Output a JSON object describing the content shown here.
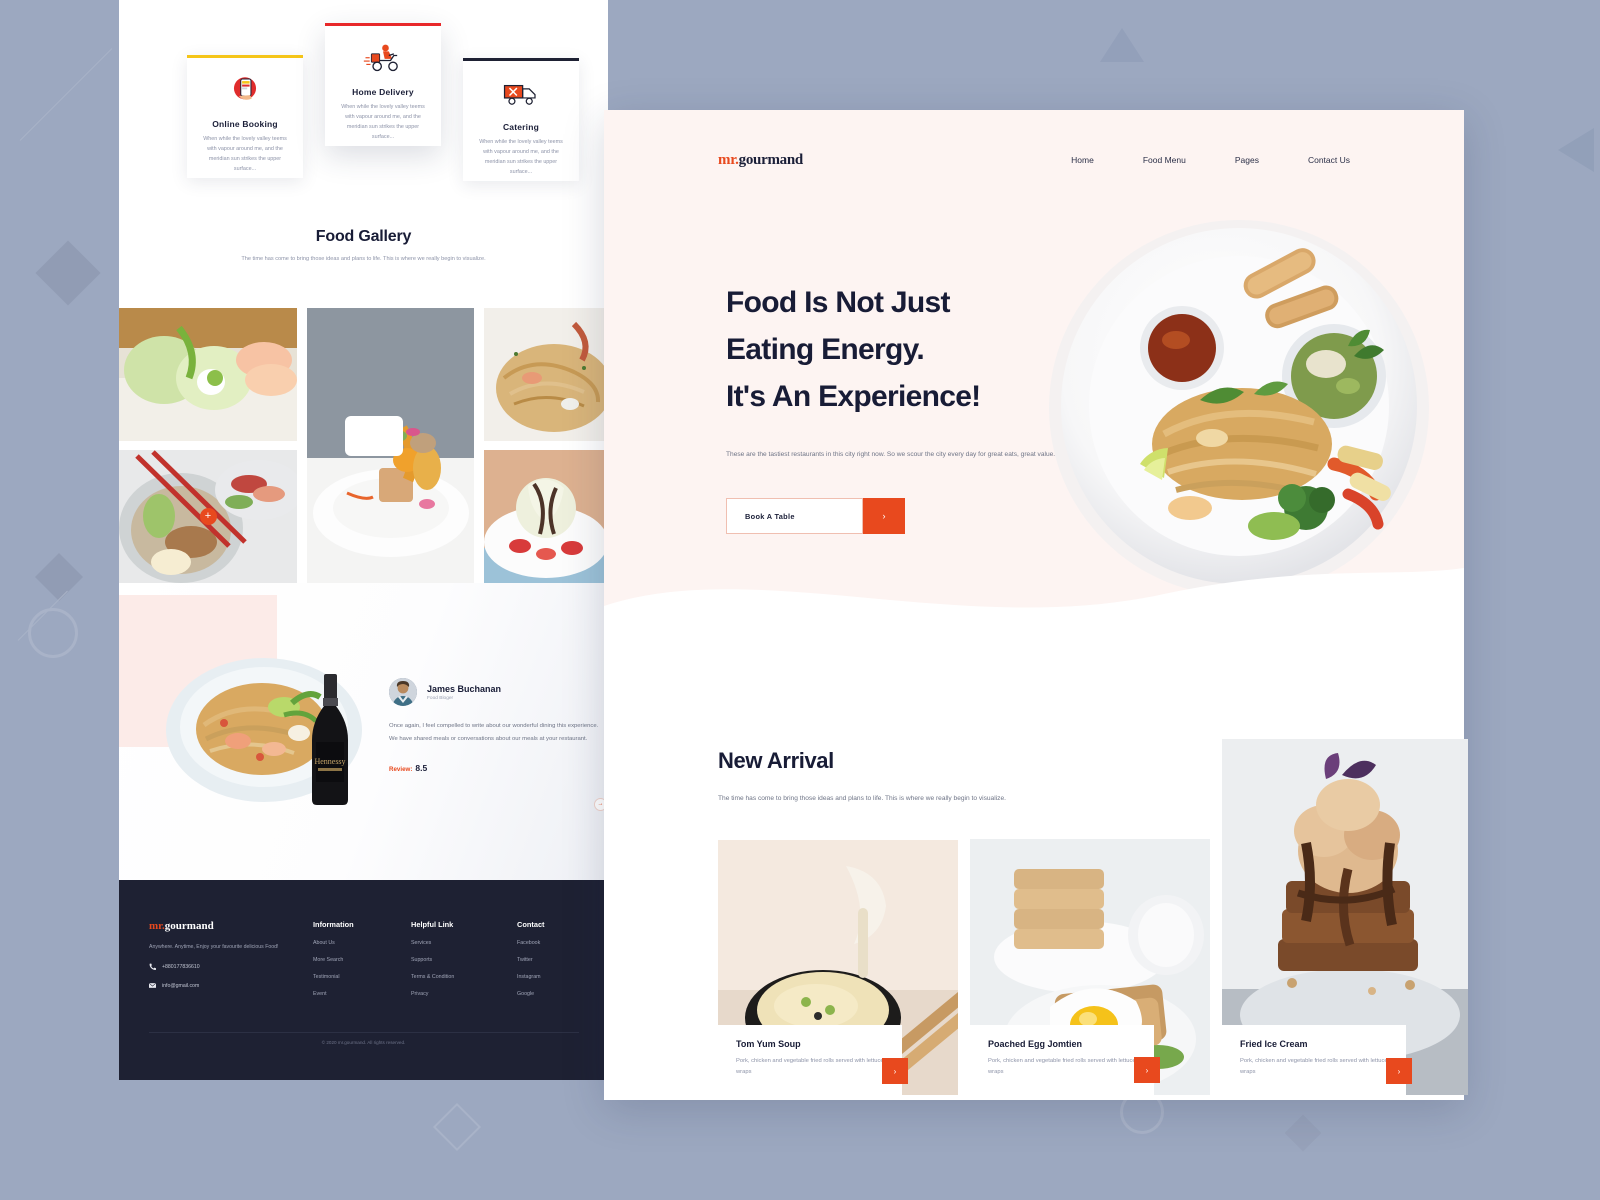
{
  "site": {
    "logo_prefix": "mr.",
    "logo_name": "gourmand"
  },
  "nav": {
    "items": [
      "Home",
      "Food Menu",
      "Pages",
      "Contact Us"
    ]
  },
  "hero": {
    "heading_line1": "Food Is Not Just",
    "heading_line2": "Eating Energy.",
    "heading_line3": "It's An Experience!",
    "subtext": "These are the tastiest restaurants in this city right now. So we scour the city every day for great eats, great value.",
    "cta_label": "Book  A Table",
    "cta_arrow": "›"
  },
  "new_arrival": {
    "title": "New Arrival",
    "subtext": "The time has come to bring those ideas and plans to life. This is where we really begin to visualize.",
    "cards": [
      {
        "title": "Tom Yum Soup",
        "desc": "Pork, chicken and vegetable fried rolls served with lettuce wraps",
        "arrow": "›"
      },
      {
        "title": "Poached Egg Jomtien",
        "desc": "Pork, chicken and vegetable fried rolls served with lettuce wraps",
        "arrow": "›"
      },
      {
        "title": "Fried Ice Cream",
        "desc": "Pork, chicken and vegetable fried rolls served with lettuce wraps",
        "arrow": "›"
      }
    ]
  },
  "services": [
    {
      "title": "Online Booking",
      "desc": "When while the lovely valley teems with vapour around me, and the meridian sun strikes the upper surface...",
      "bar_color": "#f5c518",
      "icon": "mobile-booking-icon"
    },
    {
      "title": "Home Delivery",
      "desc": "When while the lovely valley teems with vapour around me, and the meridian sun strikes the upper surface...",
      "bar_color": "#e8282a",
      "icon": "scooter-delivery-icon"
    },
    {
      "title": "Catering",
      "desc": "When while the lovely valley teems with vapour around me, and the meridian sun strikes the upper surface...",
      "bar_color": "#1e2133",
      "icon": "catering-truck-icon"
    }
  ],
  "gallery": {
    "title": "Food Gallery",
    "subtext": "The time has come to bring those ideas and plans to life. This is where we really begin to visualize.",
    "plus_label": "+"
  },
  "testimonial": {
    "name": "James Buchanan",
    "role": "Food Bloger",
    "quote": "Once again, I feel compelled to write about our wonderful dining this experience. We have shared meals or conversations about our meals at your restaurant.",
    "review_label": "Review:",
    "review_score": "8.5",
    "arrow": "→"
  },
  "footer": {
    "logo_prefix": "mr.",
    "logo_name": "gourmand",
    "description": "Anywhere. Anytime, Enjoy your favourite delicious Food!",
    "phone": "+880177836610",
    "email": "info@gmail.com",
    "columns": [
      {
        "heading": "Information",
        "links": [
          "About Us",
          "More Search",
          "Testimonial",
          "Event"
        ]
      },
      {
        "heading": "Helpful Link",
        "links": [
          "Services",
          "Supports",
          "Terms & Condition",
          "Privacy"
        ]
      },
      {
        "heading": "Contact",
        "links": [
          "Facebook",
          "Twitter",
          "Instagram",
          "Google"
        ]
      }
    ],
    "copyright": "© 2020 mr.gourmand. All rights reserved."
  },
  "colors": {
    "accent": "#e8491e",
    "dark": "#181c36",
    "page_bg": "#9ca8c0",
    "hero_bg": "#fdf4f2",
    "footer_bg": "#1e2133"
  }
}
